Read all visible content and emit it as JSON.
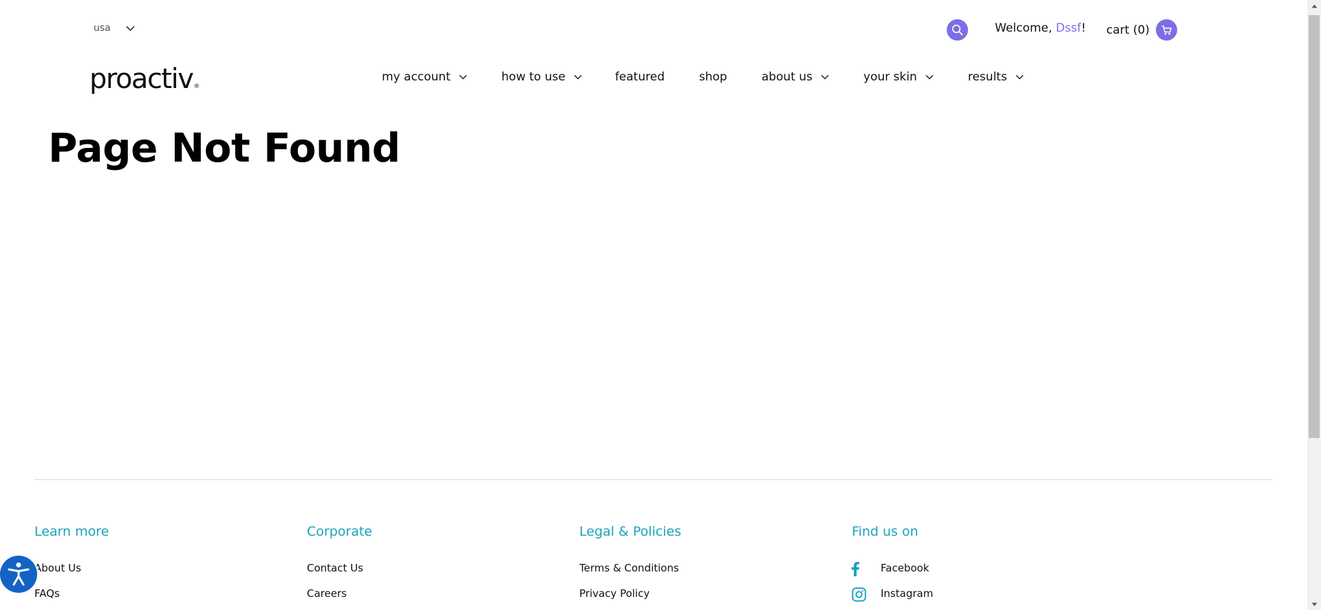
{
  "header": {
    "country": "usa",
    "welcome_prefix": "Welcome, ",
    "user_name": "Dssf",
    "welcome_suffix": "!",
    "cart_label": "cart (0)",
    "logo": "proactiv",
    "logo_mark": "®"
  },
  "nav": [
    {
      "label": "my account",
      "has_dropdown": true
    },
    {
      "label": "how to use",
      "has_dropdown": true
    },
    {
      "label": "featured",
      "has_dropdown": false
    },
    {
      "label": "shop",
      "has_dropdown": false
    },
    {
      "label": "about us",
      "has_dropdown": true
    },
    {
      "label": "your skin",
      "has_dropdown": true
    },
    {
      "label": "results",
      "has_dropdown": true
    }
  ],
  "main": {
    "title": "Page Not Found"
  },
  "footer": {
    "columns": [
      {
        "title": "Learn more",
        "links": [
          "About Us",
          "FAQs"
        ]
      },
      {
        "title": "Corporate",
        "links": [
          "Contact Us",
          "Careers"
        ]
      },
      {
        "title": "Legal & Policies",
        "links": [
          "Terms & Conditions",
          "Privacy Policy"
        ]
      },
      {
        "title": "Find us on",
        "links": [
          "Facebook",
          "Instagram"
        ]
      }
    ]
  },
  "colors": {
    "accent": "#7b6ee6",
    "footer_heading": "#1ba3b9",
    "accessibility": "#1463c4"
  },
  "icons": {
    "search": "search-icon",
    "cart": "cart-icon",
    "chevron": "chevron-down-icon",
    "facebook": "facebook-icon",
    "instagram": "instagram-icon",
    "accessibility": "accessibility-icon"
  }
}
